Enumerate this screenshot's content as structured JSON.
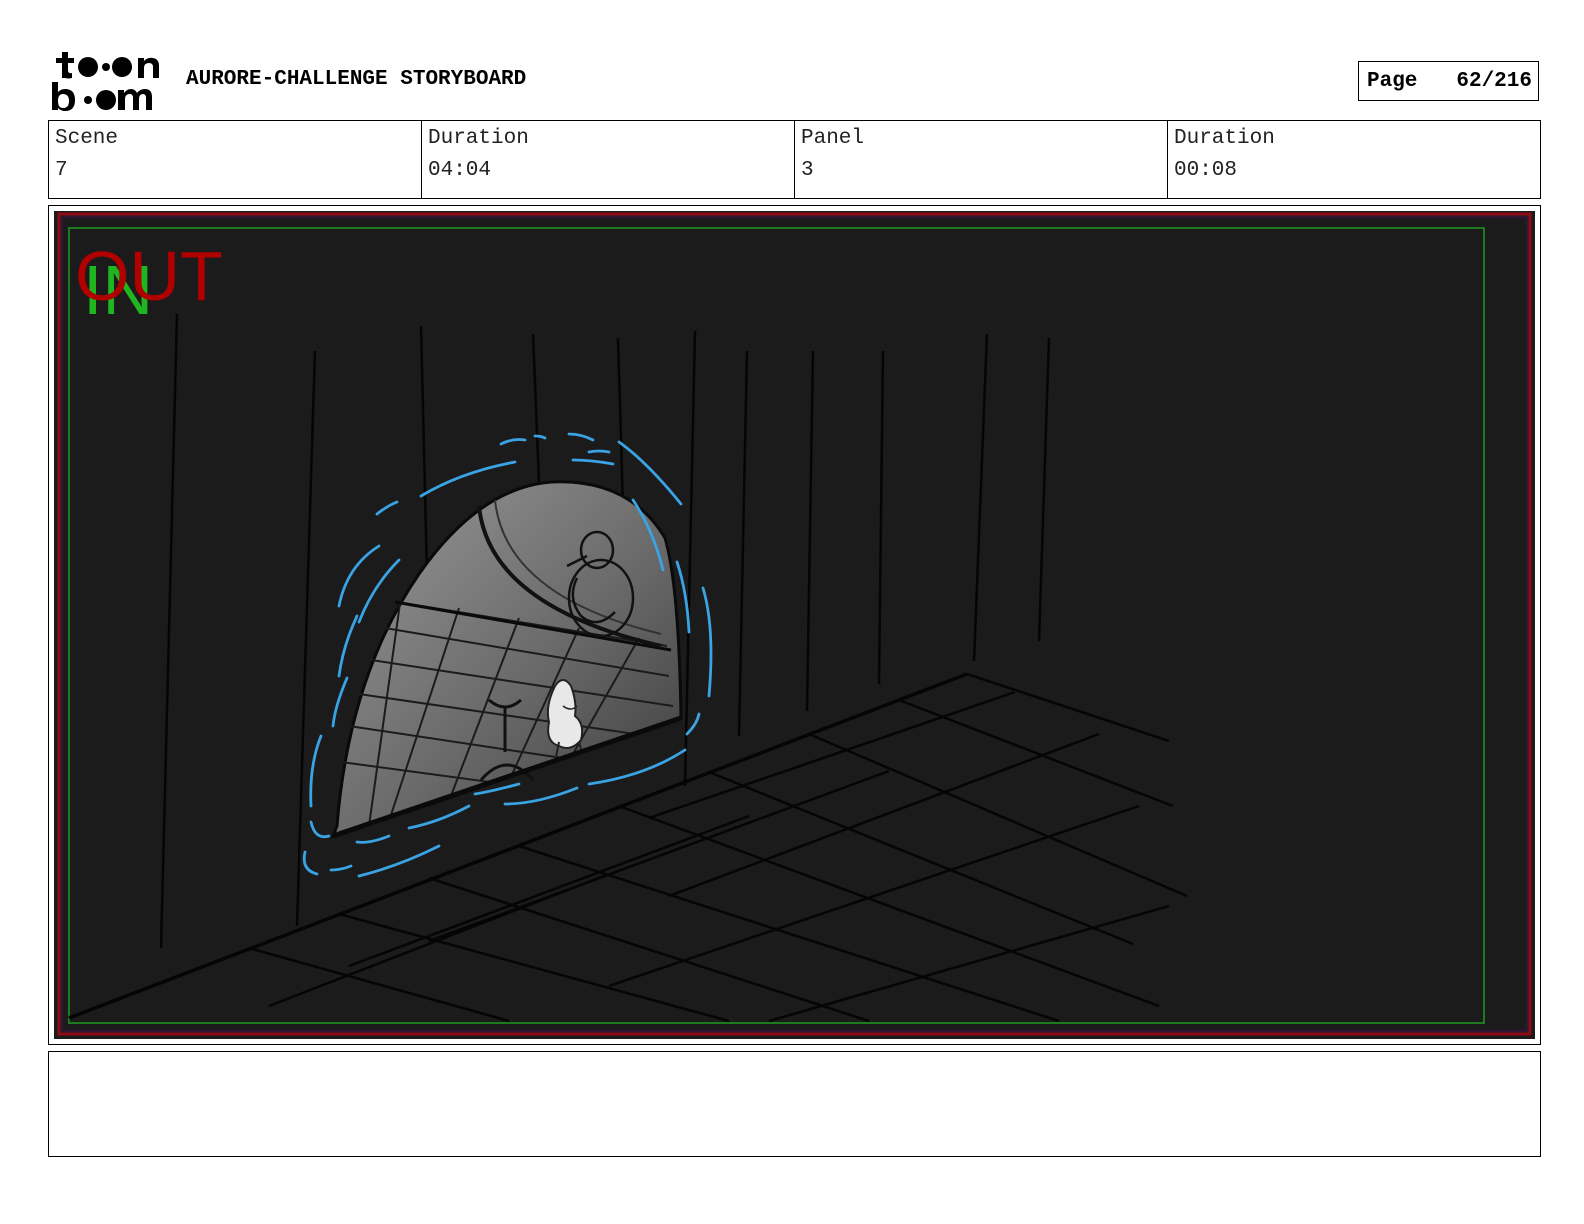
{
  "header": {
    "logo_name": "toon-boom-logo",
    "title": "AURORE-CHALLENGE STORYBOARD",
    "page_label": "Page",
    "page_value": "62/216"
  },
  "info": {
    "scene_label": "Scene",
    "scene_value": "7",
    "scene_duration_label": "Duration",
    "scene_duration_value": "04:04",
    "panel_label": "Panel",
    "panel_value": "3",
    "panel_duration_label": "Duration",
    "panel_duration_value": "00:08"
  },
  "panel": {
    "in_marker": "IN",
    "out_marker": "OUT",
    "colors": {
      "background": "#1b1b1b",
      "safe_frame_red": "#8b0b16",
      "action_frame_green": "#1e7a1e",
      "in_marker": "#1fb51f",
      "out_marker": "#b00000",
      "portal_glow": "#3aa3e3"
    }
  },
  "notes": {
    "text": ""
  }
}
